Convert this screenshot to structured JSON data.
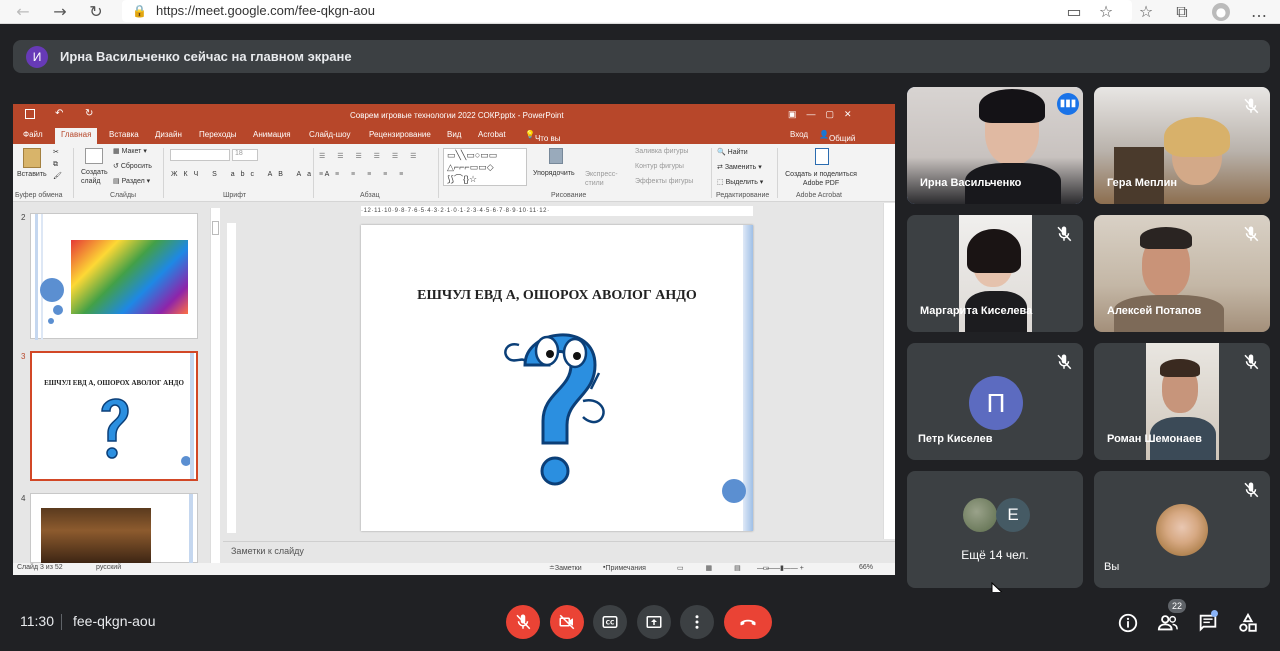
{
  "browser": {
    "url": "https://meet.google.com/fee-qkgn-aou"
  },
  "banner": {
    "avatar_letter": "И",
    "text": "Ирна Васильченко сейчас на главном экране"
  },
  "ppt": {
    "title": "Соврем игровые технологии 2022 СОКР.pptx - PowerPoint",
    "tabs": [
      "Файл",
      "Главная",
      "Вставка",
      "Дизайн",
      "Переходы",
      "Анимация",
      "Слайд-шоу",
      "Рецензирование",
      "Вид",
      "Acrobat"
    ],
    "tell_me": "Что вы хотите сделать?",
    "signin": "Вход",
    "share": "Общий доступ",
    "ribbon": {
      "paste": "Вставить",
      "create_slide": "Создать слайд",
      "layout": "Макет",
      "reset": "Сбросить",
      "section": "Раздел",
      "font_size": "18",
      "arrange": "Упорядочить",
      "quick_styles": "Экспресс-стили",
      "shape_fill": "Заливка фигуры",
      "shape_outline": "Контур фигуры",
      "shape_effects": "Эффекты фигуры",
      "find": "Найти",
      "replace": "Заменить",
      "select": "Выделить",
      "adobe": "Создать и поделиться Adobe PDF",
      "groups": [
        "Буфер обмена",
        "Слайды",
        "Шрифт",
        "Абзац",
        "Рисование",
        "Редактирование",
        "Adobe Acrobat"
      ]
    },
    "thumb_numbers": [
      "2",
      "3",
      "4"
    ],
    "thumb3_title": "ЕШЧУЛ ЕВД А, ОШОРОХ АВОЛОГ АНДО",
    "slide_title": "ЕШЧУЛ ЕВД А, ОШОРОХ АВОЛОГ АНДО",
    "ruler": "·12·11·10·9·8·7·6·5·4·3·2·1·0·1·2·3·4·5·6·7·8·9·10·11·12·",
    "notes_placeholder": "Заметки к слайду",
    "status": {
      "slide": "Слайд 3 из 52",
      "lang": "русский",
      "notes": "Заметки",
      "comments": "Примечания",
      "zoom": "66%"
    }
  },
  "participants": [
    {
      "name": "Ирна Васильченко",
      "speaking": true
    },
    {
      "name": "Гера Меплин",
      "muted": true
    },
    {
      "name": "Маргарита Киселева",
      "muted": true
    },
    {
      "name": "Алексей Потапов",
      "muted": true
    },
    {
      "name": "Петр Киселев",
      "avatar_letter": "П",
      "muted": true
    },
    {
      "name": "Роман Шемонаев",
      "muted": true
    },
    {
      "name": "Ещё 14 чел.",
      "avatar_letter": "Е"
    },
    {
      "name": "Вы",
      "muted": true
    }
  ],
  "bottom": {
    "time": "11:30",
    "meeting_code": "fee-qkgn-aou",
    "people_count": "22"
  },
  "colors": {
    "accent": "#8ab4f8",
    "danger": "#ea4335",
    "ppt": "#b7472a",
    "tile": "#3c4043",
    "bg": "#202124"
  }
}
